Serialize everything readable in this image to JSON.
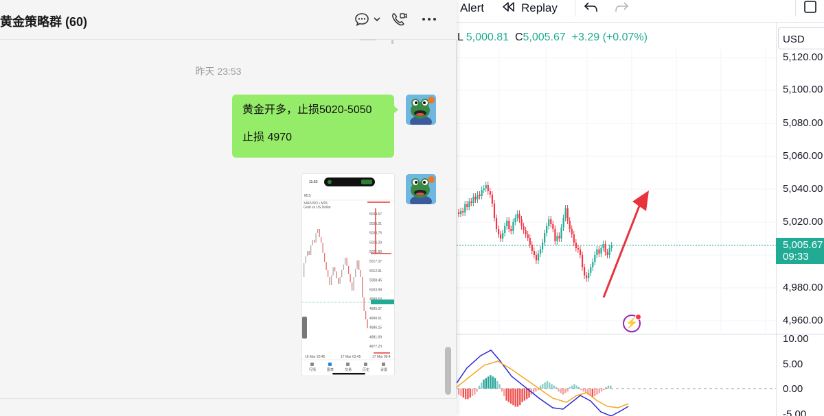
{
  "chart_window": {
    "toolbar": {
      "alert_label": "Alert",
      "replay_label": "Replay"
    },
    "ohlc": {
      "low_key": "L",
      "low_value": "5,000.81",
      "close_key": "C",
      "close_value": "5,005.67",
      "change_value": "+3.29 (+0.07%)"
    },
    "currency": "USD",
    "price_axis_labels": [
      "5,120.00",
      "5,100.00",
      "5,080.00",
      "5,060.00",
      "5,040.00",
      "5,020.00",
      "4,980.00",
      "4,960.00"
    ],
    "current_price": {
      "price": "5,005.67",
      "countdown": "09:33"
    },
    "indicator_axis_labels": [
      "10.00",
      "5.00",
      "0.00",
      "-5.00"
    ],
    "colors": {
      "up": "#22ab94",
      "down": "#f23645",
      "annotation_arrow": "#e8323c",
      "macd_line": "#2929d6",
      "signal_line": "#f5a623"
    },
    "ai_icon": "lightning-bolt-icon"
  },
  "chat": {
    "title": "黄金策略群 (60)",
    "header_icons": [
      "chat-bubble-icon",
      "chevron-down-icon",
      "phone-video-icon",
      "more-icon"
    ],
    "timestamp": "昨天 23:53",
    "message": {
      "line1": "黄金开多，止损5020-5050",
      "line2": "止损  4970"
    },
    "image_message": {
      "status_time": "11:53",
      "symbol": "XAUUSD • M15",
      "desc": "Gold vs US Dollar",
      "timeframe": "M15",
      "axis": [
        "5039.67",
        "5035.21",
        "5030.75",
        "5026.29",
        "5021.83",
        "5017.37",
        "5012.91",
        "5008.45",
        "5003.99",
        "4999.53",
        "4995.07",
        "4990.61",
        "4986.15",
        "4981.69",
        "4977.23"
      ],
      "dates": [
        "16 Mar 20:45",
        "17 Mar 03:45",
        "17 Mar 09:4"
      ],
      "tabs": [
        "行情",
        "图表",
        "交易",
        "历史",
        "设置"
      ]
    }
  }
}
